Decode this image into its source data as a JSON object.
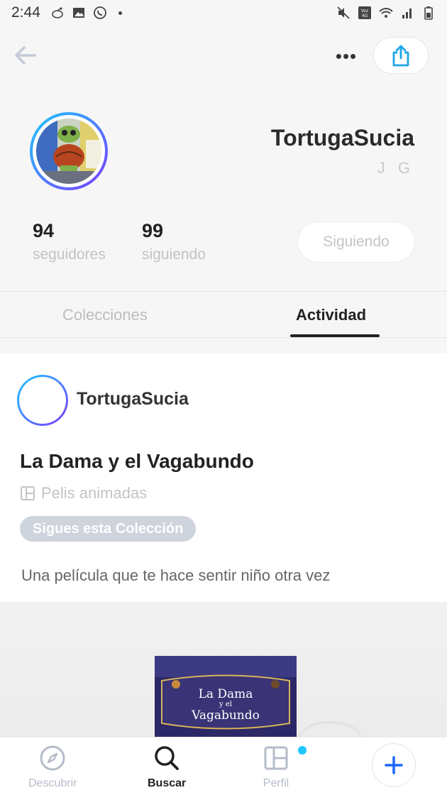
{
  "status_bar": {
    "time": "2:44",
    "left_icons": [
      "reddit-icon",
      "image-icon",
      "whatsapp-icon"
    ],
    "right_icons": [
      "mute-icon",
      "volte-icon",
      "wifi-icon",
      "signal-icon",
      "battery-icon"
    ],
    "volte_label": "Voz 4G"
  },
  "header": {
    "back_icon": "arrow-left-icon",
    "more_icon": "more-horizontal-icon",
    "more_label": "•••",
    "share_icon": "share-icon"
  },
  "profile": {
    "username": "TortugaSucia",
    "real_name": "J G",
    "followers_count": "94",
    "followers_label": "seguidores",
    "following_count": "99",
    "following_label": "siguiendo",
    "follow_button_label": "Siguiendo"
  },
  "tabs": [
    {
      "label": "Colecciones",
      "active": false
    },
    {
      "label": "Actividad",
      "active": true
    }
  ],
  "activity_card": {
    "username": "TortugaSucia",
    "title": "La Dama y el Vagabundo",
    "collection": "Pelis animadas",
    "collection_icon": "board-icon",
    "pill_label": "Sigues esta Colección",
    "description": "Una película que te hace sentir niño otra vez",
    "poster_title_line1": "La Dama",
    "poster_title_line2": "y el",
    "poster_title_line3": "Vagabundo"
  },
  "bottom_nav": [
    {
      "label": "Descubrir",
      "icon": "compass-icon",
      "active": false
    },
    {
      "label": "Buscar",
      "icon": "search-icon",
      "active": true
    },
    {
      "label": "Perfil",
      "icon": "profile-board-icon",
      "active": false,
      "badge": true
    },
    {
      "label": "",
      "icon": "plus-icon",
      "active": false
    }
  ],
  "colors": {
    "accent_gradient_start": "#1ec8ff",
    "accent_gradient_end": "#7b3cff",
    "share_icon": "#1ea5e8",
    "plus_icon": "#1a66ff",
    "badge": "#1ec8ff"
  }
}
